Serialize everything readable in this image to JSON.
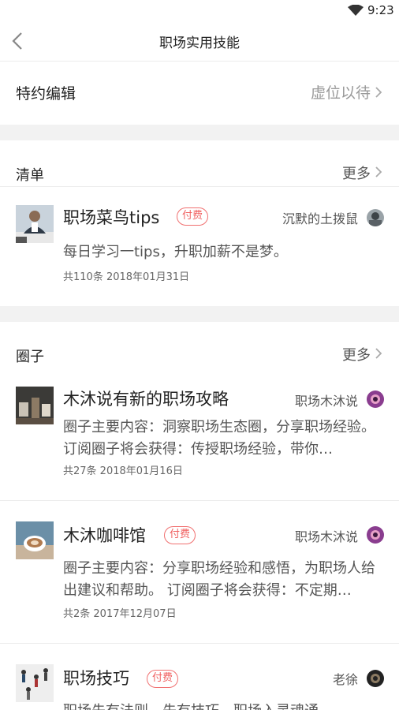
{
  "status_bar": {
    "time": "9:23"
  },
  "nav": {
    "title": "职场实用技能"
  },
  "editor_row": {
    "label": "特约编辑",
    "value": "虚位以待"
  },
  "lists_section": {
    "title": "清单",
    "more": "更多",
    "items": [
      {
        "title": "职场菜鸟tips",
        "badge": "付费",
        "author": "沉默的土拨鼠",
        "description": "每日学习一tips，升职加薪不是梦。",
        "meta": "共110条  2018年01月31日"
      }
    ]
  },
  "circles_section": {
    "title": "圈子",
    "more": "更多",
    "items": [
      {
        "title": "木沐说有新的职场攻略",
        "author": "职场木沐说",
        "description": "圈子主要内容：洞察职场生态圈，分享职场经验。 订阅圈子将会获得：传授职场经验，带你…",
        "meta": "共27条  2018年01月16日"
      },
      {
        "title": "木沐咖啡馆",
        "badge": "付费",
        "author": "职场木沐说",
        "description": "圈子主要内容：分享职场经验和感悟，为职场人给出建议和帮助。 订阅圈子将会获得：不定期…",
        "meta": "共2条  2017年12月07日"
      },
      {
        "title": "职场技巧",
        "badge": "付费",
        "author": "老徐",
        "description": "职场先有法则，先有技巧，职场入灵魂通"
      }
    ]
  },
  "colors": {
    "badge": "#f06060",
    "gap": "#f2f2f2",
    "divider": "#ececec"
  }
}
